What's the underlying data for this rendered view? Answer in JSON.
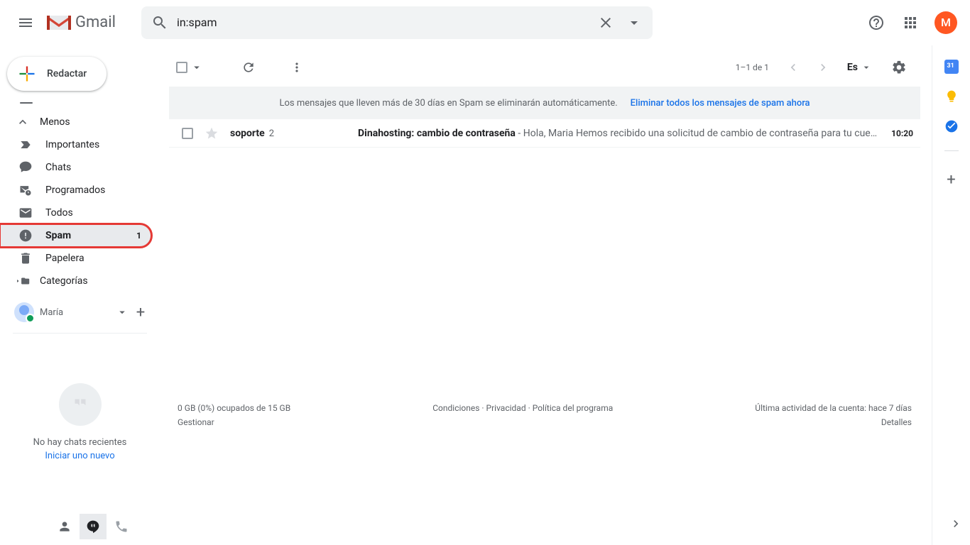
{
  "header": {
    "brand": "Gmail",
    "search_value": "in:spam",
    "avatar_letter": "M"
  },
  "sidebar": {
    "compose": "Redactar",
    "less": "Menos",
    "items": [
      {
        "label": "Importantes"
      },
      {
        "label": "Chats"
      },
      {
        "label": "Programados"
      },
      {
        "label": "Todos"
      },
      {
        "label": "Spam",
        "count": "1",
        "active": true
      },
      {
        "label": "Papelera"
      },
      {
        "label": "Categorías"
      }
    ],
    "chat_user": "María",
    "no_chats": "No hay chats recientes",
    "start_chat": "Iniciar uno nuevo"
  },
  "toolbar": {
    "pager": "1–1 de 1",
    "lang": "Es"
  },
  "banner": {
    "text": "Los mensajes que lleven más de 30 días en Spam se eliminarán automáticamente.",
    "link": "Eliminar todos los mensajes de spam ahora"
  },
  "messages": [
    {
      "sender": "soporte",
      "count": "2",
      "subject": "Dinahosting: cambio de contraseña",
      "snippet": " - Hola, Maria Hemos recibido una solicitud de cambio de contraseña para tu cue…",
      "time": "10:20"
    }
  ],
  "footer": {
    "storage": "0 GB (0%) ocupados de 15 GB",
    "manage": "Gestionar",
    "terms": "Condiciones",
    "privacy": "Privacidad",
    "program": "Política del programa",
    "activity": "Última actividad de la cuenta: hace 7 días",
    "details": "Detalles"
  }
}
